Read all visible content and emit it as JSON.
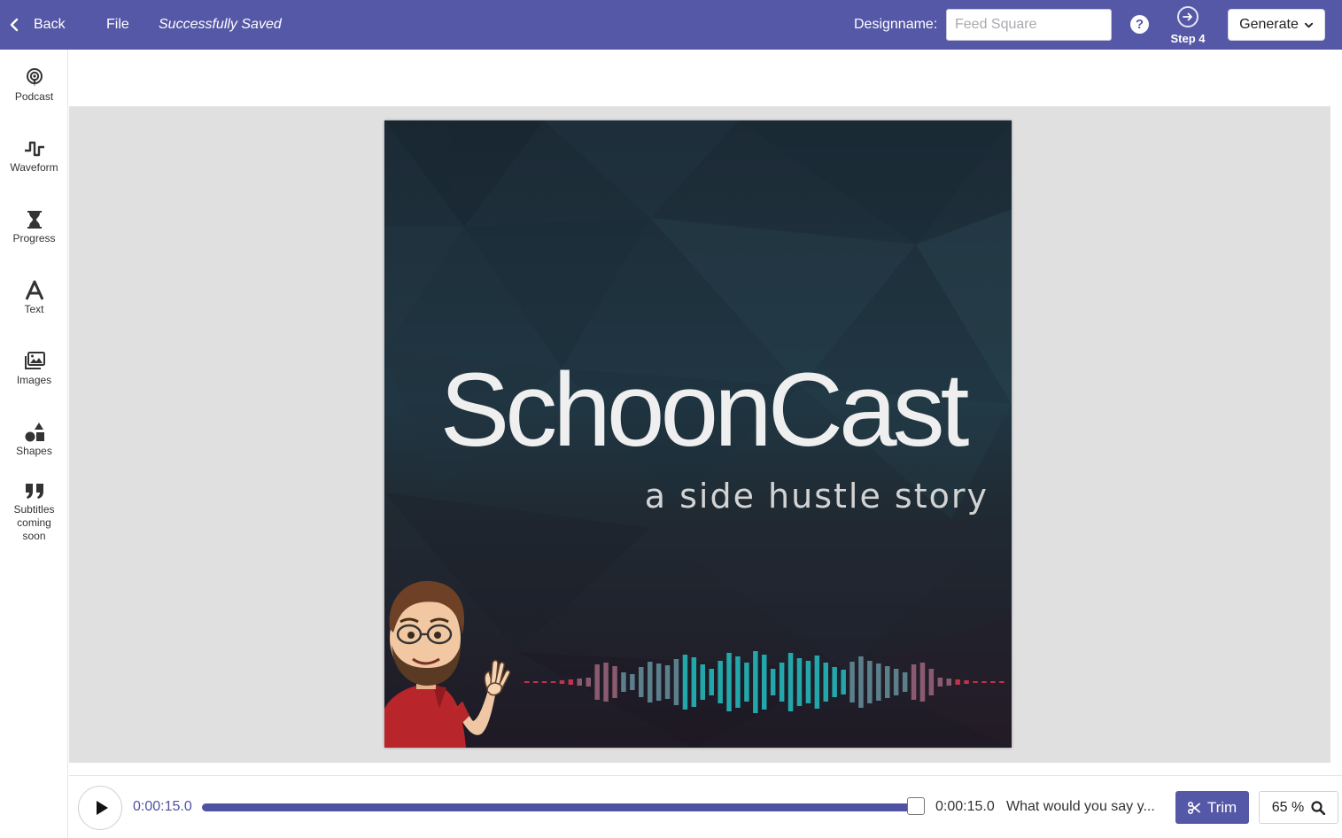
{
  "topbar": {
    "back_label": "Back",
    "file_label": "File",
    "status": "Successfully Saved",
    "designname_label": "Designname:",
    "designname_placeholder": "Feed Square",
    "designname_value": "",
    "help_icon": "question-circle-icon",
    "step_label": "Step 4",
    "generate_label": "Generate"
  },
  "sidebar": {
    "items": [
      {
        "label": "Podcast",
        "icon": "podcast-icon"
      },
      {
        "label": "Waveform",
        "icon": "waveform-icon"
      },
      {
        "label": "Progress",
        "icon": "hourglass-icon"
      },
      {
        "label": "Text",
        "icon": "text-icon"
      },
      {
        "label": "Images",
        "icon": "images-icon"
      },
      {
        "label": "Shapes",
        "icon": "shapes-icon"
      },
      {
        "label": "Subtitles coming soon",
        "icon": "quote-icon"
      }
    ]
  },
  "artwork": {
    "title": "SchoonCast",
    "subtitle": "a side hustle story",
    "colors": {
      "bg_top": "#1c2a35",
      "bg_bottom": "#1f1a25",
      "wave_teal": "#23a7ab",
      "wave_red": "#c0334c"
    }
  },
  "controls": {
    "current_time": "0:00:15.0",
    "end_time": "0:00:15.0",
    "caption_preview": "What would you say y...",
    "progress": 1.0,
    "trim_label": "Trim",
    "zoom_label": "65 %"
  },
  "theme": {
    "accent": "#5558a6"
  }
}
